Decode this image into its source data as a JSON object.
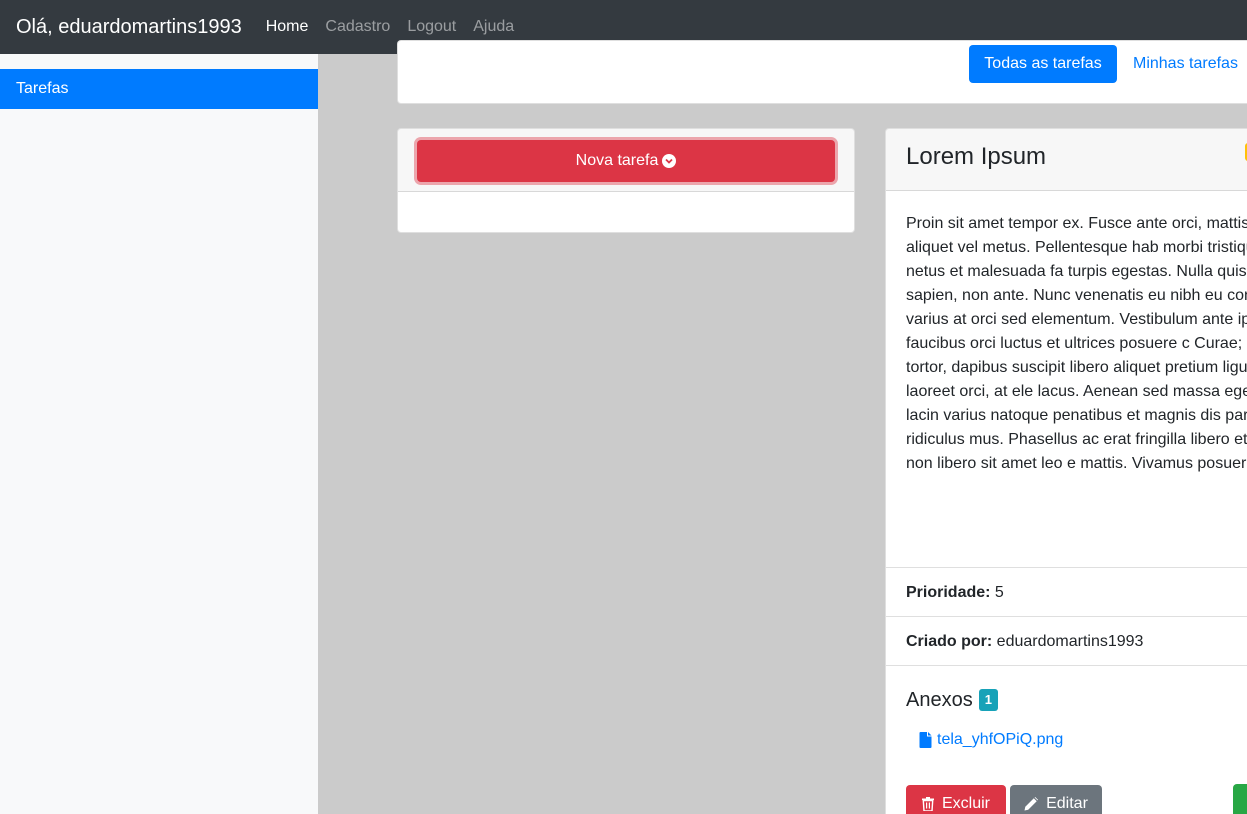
{
  "navbar": {
    "brand": "Olá, eduardomartins1993",
    "links": [
      "Home",
      "Cadastro",
      "Logout",
      "Ajuda"
    ]
  },
  "sidebar": {
    "items": [
      {
        "label": "Tarefas"
      }
    ]
  },
  "filters": {
    "all_label": "Todas as tarefas",
    "mine_label": "Minhas tarefas"
  },
  "new_task": {
    "label": "Nova tarefa"
  },
  "task": {
    "title": "Lorem Ipsum",
    "description": "Proin sit amet tempor ex. Fusce ante orci, mattis eleifend sed, aliquet vel metus. Pellentesque hab morbi tristique senectus et netus et malesuada fa turpis egestas. Nulla quis dignissim sapien, non ante. Nunc venenatis eu nibh eu consequat. Aen varius at orci sed elementum. Vestibulum ante ip primis in faucibus orci luctus et ultrices posuere c Curae; Cras sapien tortor, dapibus suscipit libero aliquet pretium ligula. Sed vel laoreet orci, at ele lacus. Aenean sed massa eget velit lacinia lacin varius natoque penatibus et magnis dis parturien nascetur ridiculus mus. Phasellus ac erat fringilla libero et, lobortis odio. In non libero sit amet leo e mattis. Vivamus posuere viverra finibus.",
    "priority_label": "Prioridade:",
    "priority_value": "5",
    "created_by_label": "Criado por:",
    "created_by_value": "eduardomartins1993",
    "attachments_label": "Anexos",
    "attachments_count": "1",
    "attachments": [
      {
        "name": "tela_yhfOPiQ.png"
      }
    ],
    "delete_label": "Excluir",
    "edit_label": "Editar"
  },
  "colors": {
    "primary": "#007bff",
    "danger": "#dc3545",
    "secondary": "#6c757d",
    "info": "#17a2b8",
    "success": "#28a745",
    "warning": "#ffc107",
    "navbar": "#343a40"
  }
}
